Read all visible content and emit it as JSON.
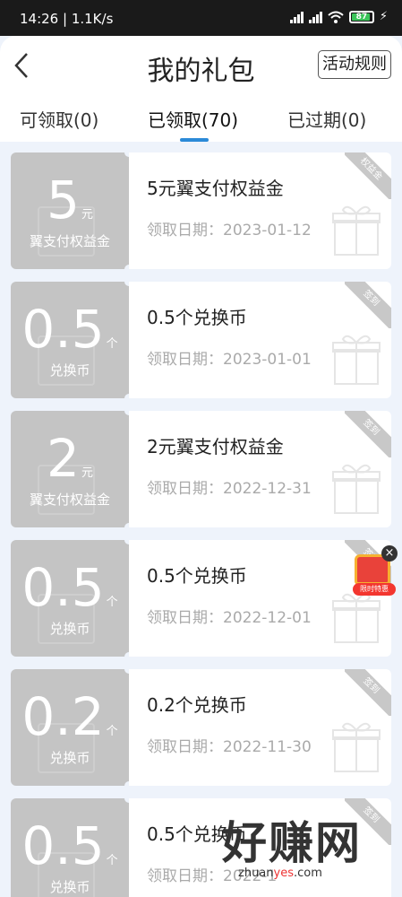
{
  "status_bar": {
    "time": "14:26",
    "speed": "1.1K/s",
    "battery": "87"
  },
  "header": {
    "title": "我的礼包",
    "rules_button": "活动规则"
  },
  "tabs": [
    {
      "label": "可领取(0)",
      "active": false
    },
    {
      "label": "已领取(70)",
      "active": true
    },
    {
      "label": "已过期(0)",
      "active": false
    }
  ],
  "cards": [
    {
      "amount": "5",
      "unit": "元",
      "kind": "翼支付权益金",
      "title": "5元翼支付权益金",
      "date_label": "领取日期：",
      "date": "2023-01-12",
      "ribbon": "权益金"
    },
    {
      "amount": "0.5",
      "unit": "个",
      "kind": "兑换币",
      "title": "0.5个兑换币",
      "date_label": "领取日期：",
      "date": "2023-01-01",
      "ribbon": "签到"
    },
    {
      "amount": "2",
      "unit": "元",
      "kind": "翼支付权益金",
      "title": "2元翼支付权益金",
      "date_label": "领取日期：",
      "date": "2022-12-31",
      "ribbon": "签到"
    },
    {
      "amount": "0.5",
      "unit": "个",
      "kind": "兑换币",
      "title": "0.5个兑换币",
      "date_label": "领取日期：",
      "date": "2022-12-01",
      "ribbon": "签到"
    },
    {
      "amount": "0.2",
      "unit": "个",
      "kind": "兑换币",
      "title": "0.2个兑换币",
      "date_label": "领取日期：",
      "date": "2022-11-30",
      "ribbon": "签到"
    },
    {
      "amount": "0.5",
      "unit": "个",
      "kind": "兑换币",
      "title": "0.5个兑换币",
      "date_label": "领取日期：",
      "date": "2022-1",
      "ribbon": "签到"
    }
  ],
  "floating_promo": {
    "label": "限时特惠",
    "close": "×"
  },
  "watermark": {
    "main": "好赚网",
    "url_prefix": "zhuan",
    "url_highlight": "yes",
    "url_suffix": ".com"
  },
  "colors": {
    "accent": "#2b8ad8",
    "card_grey": "#c4c4c4",
    "background": "#eef3fb"
  }
}
